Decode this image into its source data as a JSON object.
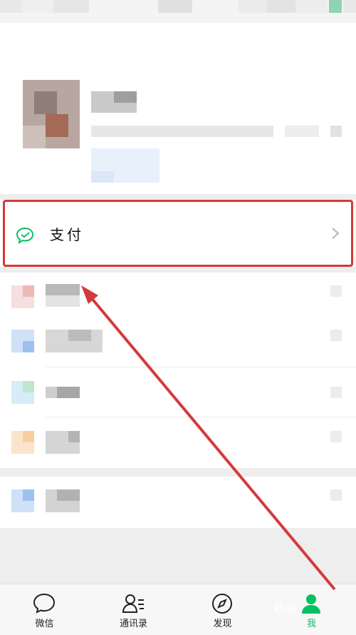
{
  "pay": {
    "label": "支付"
  },
  "tabs": [
    {
      "label": "微信",
      "icon": "chat-bubble-icon",
      "active": false
    },
    {
      "label": "通讯录",
      "icon": "contacts-icon",
      "active": false
    },
    {
      "label": "发现",
      "icon": "compass-icon",
      "active": false
    },
    {
      "label": "我",
      "icon": "me-icon",
      "active": true
    }
  ],
  "watermark": {
    "text": "Bai"
  },
  "colors": {
    "accent": "#07c160",
    "highlight": "#d33a3a",
    "background": "#eeeeee"
  }
}
